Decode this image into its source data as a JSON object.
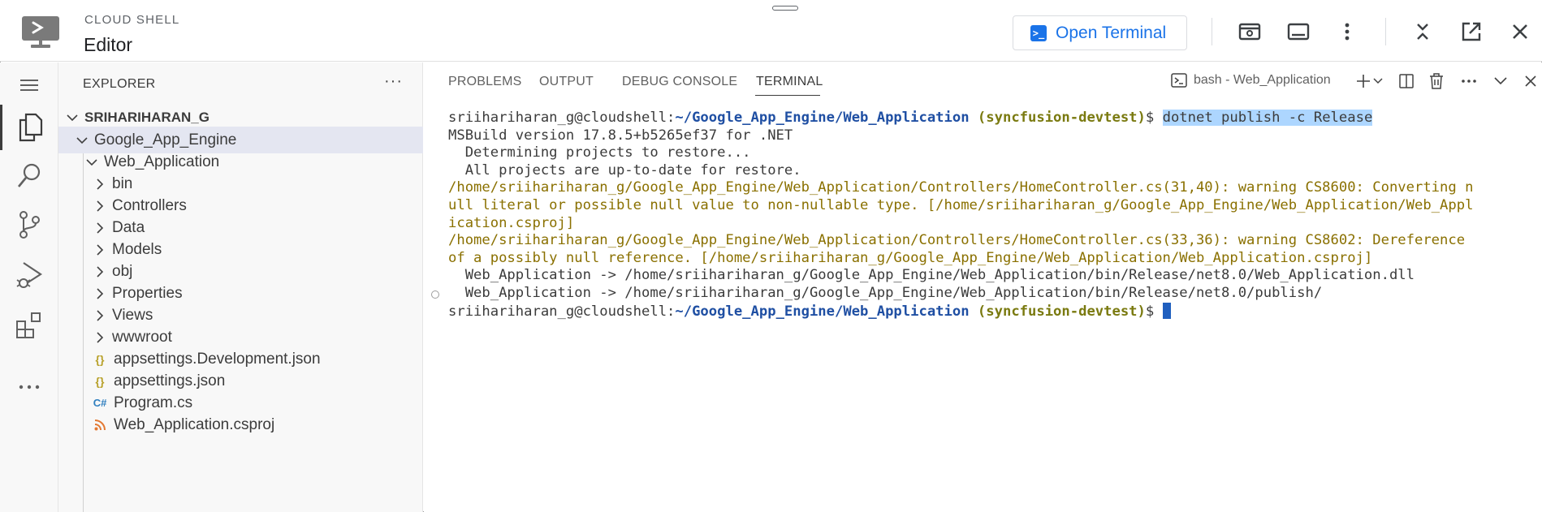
{
  "header": {
    "subtitle": "CLOUD SHELL",
    "title": "Editor",
    "open_terminal_label": "Open Terminal"
  },
  "explorer": {
    "title": "EXPLORER",
    "more_label": "···",
    "root": "SRIHARIHARAN_G",
    "items": [
      {
        "label": "Google_App_Engine",
        "type": "folder-open"
      },
      {
        "label": "Web_Application",
        "type": "folder-open"
      },
      {
        "label": "bin",
        "type": "folder"
      },
      {
        "label": "Controllers",
        "type": "folder"
      },
      {
        "label": "Data",
        "type": "folder"
      },
      {
        "label": "Models",
        "type": "folder"
      },
      {
        "label": "obj",
        "type": "folder"
      },
      {
        "label": "Properties",
        "type": "folder"
      },
      {
        "label": "Views",
        "type": "folder"
      },
      {
        "label": "wwwroot",
        "type": "folder"
      },
      {
        "label": "appsettings.Development.json",
        "type": "json",
        "icon": "{}"
      },
      {
        "label": "appsettings.json",
        "type": "json",
        "icon": "{}"
      },
      {
        "label": "Program.cs",
        "type": "csharp",
        "icon": "C#"
      },
      {
        "label": "Web_Application.csproj",
        "type": "rss",
        "icon": "rss"
      }
    ]
  },
  "panel": {
    "tabs": [
      "PROBLEMS",
      "OUTPUT",
      "DEBUG CONSOLE",
      "TERMINAL"
    ],
    "active_tab": "TERMINAL",
    "terminal_selector": "bash - Web_Application"
  },
  "terminal": {
    "prompt_user": "sriihariharan_g@cloudshell:",
    "prompt_path": "~/Google_App_Engine/Web_Application",
    "prompt_project": "(syncfusion-devtest)",
    "prompt_symbol": "$ ",
    "command": "dotnet publish -c Release",
    "lines": [
      "MSBuild version 17.8.5+b5265ef37 for .NET",
      "  Determining projects to restore...",
      "  All projects are up-to-date for restore."
    ],
    "warnings": [
      "/home/sriihariharan_g/Google_App_Engine/Web_Application/Controllers/HomeController.cs(31,40): warning CS8600: Converting n",
      "ull literal or possible null value to non-nullable type. [/home/sriihariharan_g/Google_App_Engine/Web_Application/Web_Appl",
      "ication.csproj]",
      "/home/sriihariharan_g/Google_App_Engine/Web_Application/Controllers/HomeController.cs(33,36): warning CS8602: Dereference",
      "of a possibly null reference. [/home/sriihariharan_g/Google_App_Engine/Web_Application/Web_Application.csproj]"
    ],
    "outputs": [
      "  Web_Application -> /home/sriihariharan_g/Google_App_Engine/Web_Application/bin/Release/net8.0/Web_Application.dll",
      "  Web_Application -> /home/sriihariharan_g/Google_App_Engine/Web_Application/bin/Release/net8.0/publish/"
    ]
  },
  "colors": {
    "accent": "#1a73e8",
    "terminal_path": "#1f4fa3",
    "terminal_warning": "#8a7000",
    "selection": "#add6ff"
  }
}
